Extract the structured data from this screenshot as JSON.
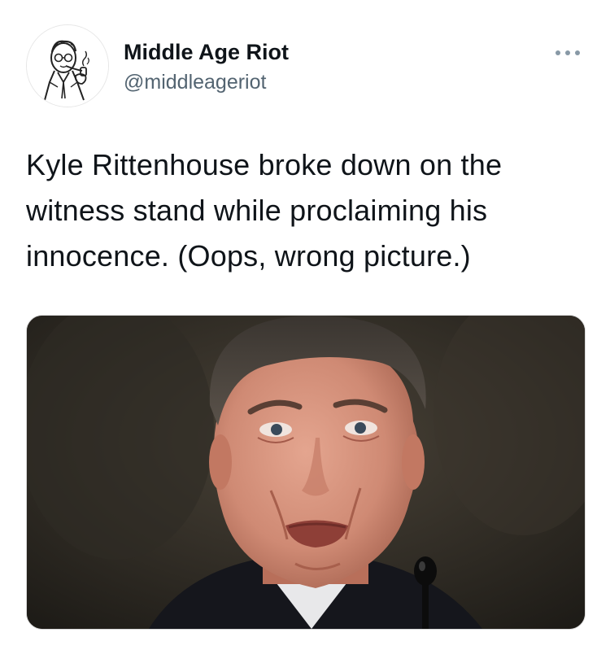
{
  "author": {
    "display_name": "Middle Age Riot",
    "handle": "@middleageriot",
    "avatar_icon": "pipe-smoking-man-avatar"
  },
  "more_options_icon": "ellipsis-icon",
  "tweet": {
    "text_lines": [
      "Kyle Rittenhouse broke down on the",
      "witness stand while proclaiming his",
      "innocence. (Oops, wrong picture.)"
    ]
  },
  "media": {
    "type": "photo"
  },
  "colors": {
    "text_primary": "#0f1419",
    "text_secondary": "#536471",
    "border": "#d9d9d9",
    "icon_gray": "#8899a6"
  }
}
